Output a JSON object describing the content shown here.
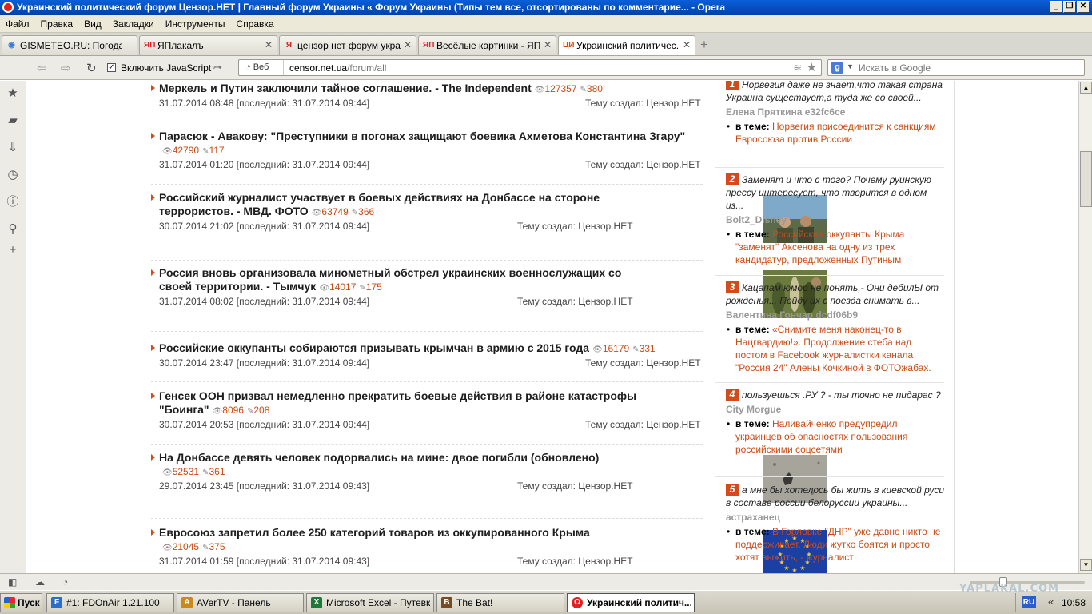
{
  "window": {
    "title": "Украинский политический форум Цензор.НЕТ | Главный форум Украины « Форум Украины (Типы тем все, отсортированы по комментарие... - Opera",
    "buttons": [
      "_",
      "❐",
      "✕"
    ]
  },
  "menu": [
    "Файл",
    "Правка",
    "Вид",
    "Закладки",
    "Инструменты",
    "Справка"
  ],
  "tabs": [
    {
      "label": "GISMETEO.RU: Погода ...",
      "icon": "◉",
      "color": "#3a7bd5"
    },
    {
      "label": "ЯПлакалъ",
      "icon": "ЯП",
      "color": "#d22"
    },
    {
      "label": "цензор нет форум укра...",
      "icon": "Я",
      "color": "#d22"
    },
    {
      "label": "Весёлые картинки - ЯП...",
      "icon": "ЯП",
      "color": "#d22"
    },
    {
      "label": "Украинский политичес...",
      "icon": "ЦИ",
      "color": "#c94c16"
    }
  ],
  "toolbar": {
    "js_label": "Включить JavaScript",
    "js_checked": "✓",
    "url_prefix": "Веб",
    "url_host": "censor.net.ua",
    "url_path": "/forum/all",
    "search_placeholder": "Искать в Google"
  },
  "topics": [
    {
      "title": "Меркель и Путин заключили тайное соглашение. - The Independent",
      "views": "127357",
      "comments": "380",
      "date": "31.07.2014 08:48",
      "last": "[последний: 31.07.2014 09:44]",
      "creator": "Тему создал: Цензор.НЕТ",
      "thumb": ""
    },
    {
      "title": "Парасюк - Авакову: \"Преступники в погонах защищают боевика Ахметова Константина Згару\"",
      "views": "42790",
      "comments": "117",
      "date": "31.07.2014 01:20",
      "last": "[последний: 31.07.2014 09:44]",
      "creator": "Тему создал: Цензор.НЕТ",
      "thumb": ""
    },
    {
      "title": "Российский журналист участвует в боевых действиях на Донбассе на стороне террористов. - МВД. ФОТО",
      "views": "63749",
      "comments": "366",
      "date": "30.07.2014 21:02",
      "last": "[последний: 31.07.2014 09:44]",
      "creator": "Тему создал: Цензор.НЕТ",
      "thumb": "soldiers"
    },
    {
      "title": "Россия вновь организовала минометный обстрел украинских военнослужащих со своей территории. - Тымчук",
      "views": "14017",
      "comments": "175",
      "date": "31.07.2014 08:02",
      "last": "[последний: 31.07.2014 09:44]",
      "creator": "Тему создал: Цензор.НЕТ",
      "thumb": "mortar"
    },
    {
      "title": "Российские оккупанты собираются призывать крымчан в армию с 2015 года",
      "views": "16179",
      "comments": "331",
      "date": "30.07.2014 23:47",
      "last": "[последний: 31.07.2014 09:44]",
      "creator": "Тему создал: Цензор.НЕТ",
      "thumb": ""
    },
    {
      "title": "Генсек ООН призвал немедленно прекратить боевые действия в районе катастрофы \"Боинга\"",
      "views": "8096",
      "comments": "208",
      "date": "30.07.2014 20:53",
      "last": "[последний: 31.07.2014 09:44]",
      "creator": "Тему создал: Цензор.НЕТ",
      "thumb": ""
    },
    {
      "title": "На Донбассе девять человек подорвались на мине: двое погибли (обновлено)",
      "views": "52531",
      "comments": "361",
      "date": "29.07.2014 23:45",
      "last": "[последний: 31.07.2014 09:43]",
      "creator": "Тему создал: Цензор.НЕТ",
      "thumb": "blast"
    },
    {
      "title": "Евросоюз запретил более 250 категорий товаров из оккупированного Крыма",
      "views": "21045",
      "comments": "375",
      "date": "31.07.2014 01:59",
      "last": "[последний: 31.07.2014 09:43]",
      "creator": "Тему создал: Цензор.НЕТ",
      "thumb": "eu"
    }
  ],
  "comments": [
    {
      "num": "1",
      "quote": "Норвегия даже не знает,что такая страна Украина существует,а туда же со своей...",
      "author": "Елена Пряткина e32fc6ce",
      "topic_label": "в теме:",
      "topic": "Норвегия присоединится к санкциям Евросоюза против России"
    },
    {
      "num": "2",
      "quote": "Заменят и что с того? Почему руинскую прессу интересует, что творится в одном из...",
      "author": "Bolt2_Disney",
      "topic_label": "в теме:",
      "topic": "Российские оккупанты Крыма \"заменят\" Аксенова на одну из трех кандидатур, предложенных Путиным"
    },
    {
      "num": "3",
      "quote": "Кацапам юмор не понять,- Они дебилЫ от рожденья... Пойду их с поезда снимать в...",
      "author": "Валентина Гончар dcdf06b9",
      "topic_label": "в теме:",
      "topic": "«Снимите меня наконец-то в Нацгвардию!». Продолжение стеба над постом в Facebook журналистки канала \"Россия 24\" Алены Кочкиной в ФОТОжабах."
    },
    {
      "num": "4",
      "quote": "пользуешься .РУ ? - ты точно не пидарас ?",
      "author": "City Morgue",
      "topic_label": "в теме:",
      "topic": "Наливайченко предупредил украинцев об опасностях пользования российскими соцсетями"
    },
    {
      "num": "5",
      "quote": "а мне бы хотелось бы жить в киевской руси в составе россии белоруссии украины...",
      "author": "астраханец",
      "topic_label": "в теме:",
      "topic": "В Горловке \"ДНР\" уже давно никто не поддерживает. Люди жутко боятся и просто хотят выжить, - журналист"
    }
  ],
  "taskbar": {
    "start": "Пуск",
    "tasks": [
      {
        "label": "#1: FDOnAir 1.21.100",
        "color": "#2a6ec8",
        "icon": "F"
      },
      {
        "label": "AVerTV - Панель",
        "color": "#c98a1a",
        "icon": "A"
      },
      {
        "label": "Microsoft Excel - Путевк...",
        "color": "#1f7a3a",
        "icon": "X"
      },
      {
        "label": "The Bat!",
        "color": "#7a4a20",
        "icon": "B"
      },
      {
        "label": "Украинский политич...",
        "color": "#d22",
        "icon": "O"
      }
    ],
    "lang": "RU",
    "arrows": "«",
    "clock": "10:58"
  },
  "watermark": "YAPLAKAL.COM"
}
